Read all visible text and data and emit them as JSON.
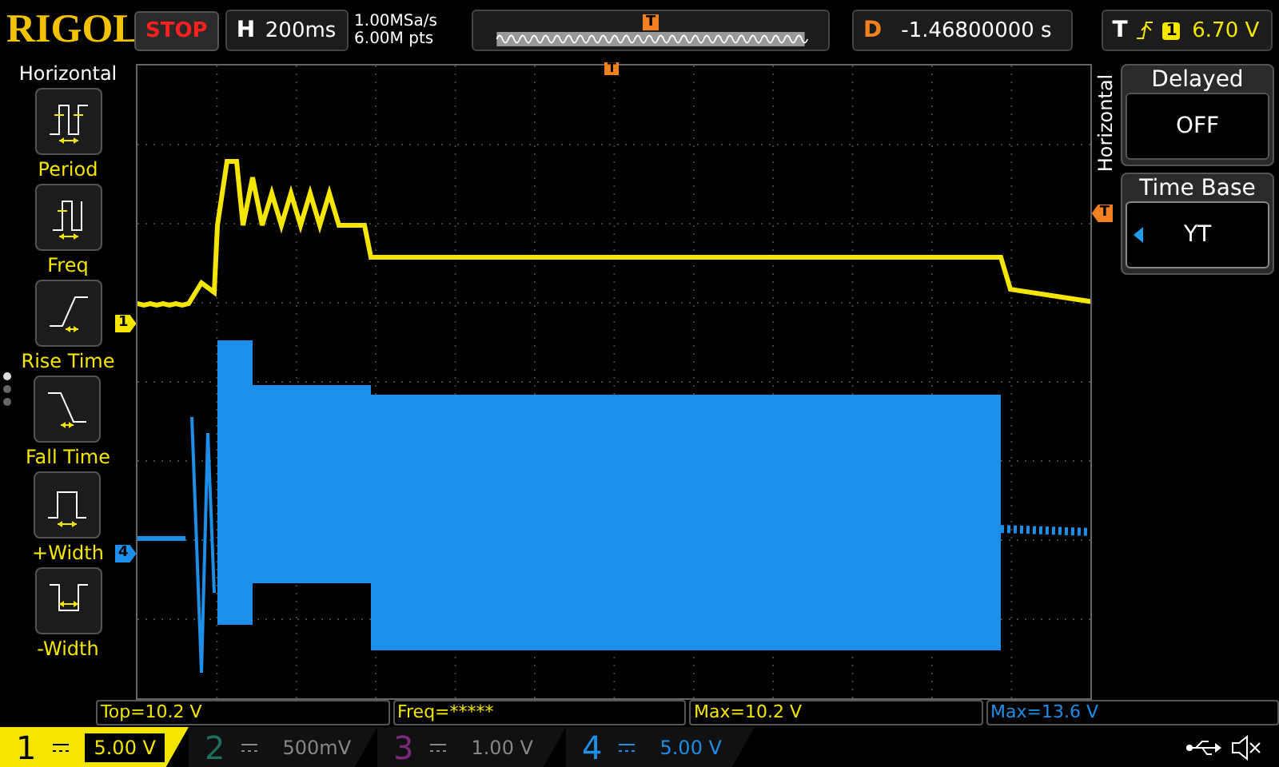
{
  "top_bar": {
    "brand": "RIGOL",
    "run_state": "STOP",
    "timebase": {
      "label": "H",
      "value": "200ms"
    },
    "sample_rate": "1.00MSa/s",
    "memory_depth": "6.00M pts",
    "memory_trigger": "T",
    "delay": {
      "label": "D",
      "value": "-1.46800000 s"
    },
    "trigger": {
      "label": "T",
      "source": "1",
      "level": "6.70 V"
    }
  },
  "left_menu": {
    "title": "Horizontal",
    "items": [
      {
        "label": "Period",
        "kind": "period"
      },
      {
        "label": "Freq",
        "kind": "freq"
      },
      {
        "label": "Rise Time",
        "kind": "rise"
      },
      {
        "label": "Fall Time",
        "kind": "fall"
      },
      {
        "label": "+Width",
        "kind": "pwidth"
      },
      {
        "label": "-Width",
        "kind": "nwidth"
      }
    ],
    "pages": [
      {
        "selected": true
      },
      {
        "selected": false
      },
      {
        "selected": false
      }
    ]
  },
  "scope": {
    "channel_markers": [
      {
        "label": "1",
        "color": "#f5e600"
      },
      {
        "label": "4",
        "color": "#1e8fe8"
      }
    ],
    "trigger_marker": "T",
    "trigger_position": "T"
  },
  "right_menu": {
    "title": "Horizontal",
    "items": [
      {
        "title": "Delayed",
        "value": "OFF",
        "selected": false
      },
      {
        "title": "Time Base",
        "value": "YT",
        "selected": true
      }
    ]
  },
  "measurements": [
    {
      "text": "Top=10.2 V",
      "color": "#f5e600"
    },
    {
      "text": "Freq=*****",
      "color": "#f5e600"
    },
    {
      "text": "Max=10.2 V",
      "color": "#f5e600"
    },
    {
      "text": "Max=13.6 V",
      "color": "#1e8fe8"
    }
  ],
  "channels": [
    {
      "number": "1",
      "scale": "5.00 V",
      "on": true,
      "selected": true,
      "color": "#f5e600"
    },
    {
      "number": "2",
      "scale": "500mV",
      "on": false,
      "selected": false,
      "color": "#1d6e5c"
    },
    {
      "number": "3",
      "scale": "1.00 V",
      "on": false,
      "selected": false,
      "color": "#7a2a76"
    },
    {
      "number": "4",
      "scale": "5.00 V",
      "on": true,
      "selected": false,
      "color": "#1e8fe8"
    }
  ]
}
